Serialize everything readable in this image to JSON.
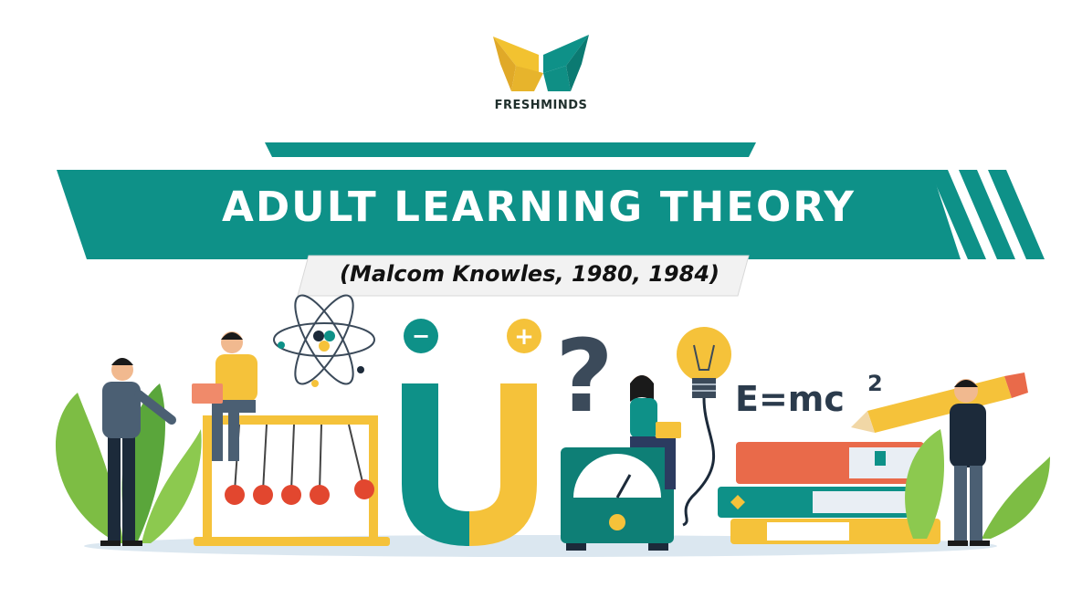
{
  "brand": {
    "name": "FRESHMINDS",
    "logo": "freshminds-butterfly-logo"
  },
  "banner": {
    "title": "ADULT LEARNING THEORY",
    "subtitle": "(Malcom Knowles, 1980, 1984)"
  },
  "illustration": {
    "formula": "E=mc",
    "formula_exponent": "2",
    "question_mark": "?",
    "magnet_minus": "−",
    "magnet_plus": "+",
    "icons": [
      "atom-icon",
      "magnet-icon",
      "question-mark-icon",
      "light-bulb-icon",
      "pencil-icon",
      "books-icon",
      "newtons-cradle-icon",
      "meter-icon"
    ]
  },
  "colors": {
    "teal": "#0e9188",
    "dark_teal": "#0b7a72",
    "yellow": "#f5c23a",
    "red": "#e2472f",
    "navy": "#2b3b4c"
  }
}
